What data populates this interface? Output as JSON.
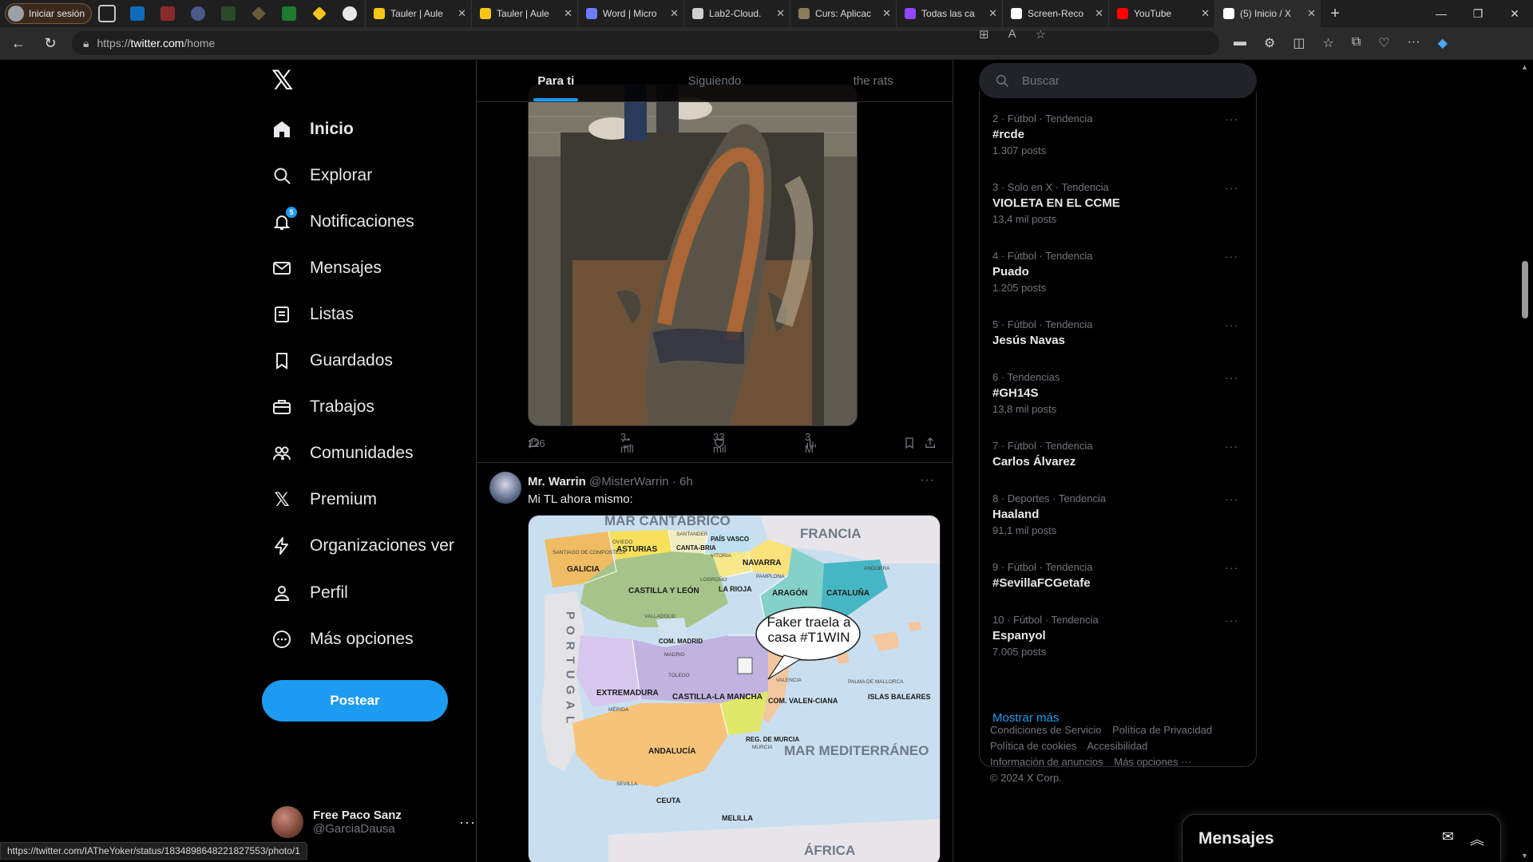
{
  "browser": {
    "profile_label": "Iniciar sesión",
    "tabs": [
      {
        "title": "Tauler | Aule",
        "color": "#f5c518"
      },
      {
        "title": "Tauler | Aule",
        "color": "#f5c518"
      },
      {
        "title": "Word | Micro",
        "color": "#6b7dff"
      },
      {
        "title": "Lab2-Cloud.",
        "color": "#cfcfcf"
      },
      {
        "title": "Curs: Aplicac",
        "color": "#8c7a5a"
      },
      {
        "title": "Todas las ca",
        "color": "#9146ff"
      },
      {
        "title": "Screen-Reco",
        "color": "#ffffff"
      },
      {
        "title": "YouTube",
        "color": "#ff0000"
      },
      {
        "title": "(5) Inicio / X",
        "color": "#ffffff"
      }
    ],
    "url_prefix": "https://",
    "url_host": "twitter.com",
    "url_path": "/home",
    "status_url": "https://twitter.com/IATheYoker/status/1834898648221827553/photo/1"
  },
  "nav": {
    "items": [
      {
        "label": "Inicio",
        "icon": "home-icon"
      },
      {
        "label": "Explorar",
        "icon": "search-icon"
      },
      {
        "label": "Notificaciones",
        "icon": "bell-icon",
        "badge": "5"
      },
      {
        "label": "Mensajes",
        "icon": "envelope-icon"
      },
      {
        "label": "Listas",
        "icon": "list-icon"
      },
      {
        "label": "Guardados",
        "icon": "bookmark-icon"
      },
      {
        "label": "Trabajos",
        "icon": "briefcase-icon"
      },
      {
        "label": "Comunidades",
        "icon": "people-icon"
      },
      {
        "label": "Premium",
        "icon": "x-logo-icon"
      },
      {
        "label": "Organizaciones ver",
        "icon": "lightning-icon"
      },
      {
        "label": "Perfil",
        "icon": "person-icon"
      },
      {
        "label": "Más opciones",
        "icon": "more-circle-icon"
      }
    ],
    "post_label": "Postear",
    "account": {
      "name": "Free Paco Sanz",
      "handle": "@GarciaDausa"
    }
  },
  "feed": {
    "tabs": [
      "Para ti",
      "Siguiendo",
      "the rats"
    ],
    "tweet1": {
      "replies": "226",
      "reposts": "3 mil",
      "likes": "33 mil",
      "views": "3 M"
    },
    "tweet2": {
      "name": "Mr. Warrin",
      "handle": "@MisterWarrin",
      "time": "6h",
      "text": "Mi TL ahora mismo:",
      "map": {
        "seas": [
          "MAR CANTÁBRICO",
          "MAR MEDITERRÁNEO"
        ],
        "countries": [
          "FRANCIA",
          "PORTUGAL",
          "ÁFRICA"
        ],
        "regions": [
          "GALICIA",
          "ASTURIAS",
          "CANTA-BRIA",
          "PAÍS VASCO",
          "NAVARRA",
          "LA RIOJA",
          "CASTILLA Y LEÓN",
          "ARAGÓN",
          "CATALUÑA",
          "COM. MADRID",
          "EXTREMADURA",
          "CASTILLA-LA MANCHA",
          "COM. VALEN-CIANA",
          "ISLAS BALEARES",
          "REG. DE MURCIA",
          "ANDALUCÍA",
          "CEUTA",
          "MELILLA"
        ],
        "cities": [
          "SANTIAGO DE COMPOSTELA",
          "OVIEDO",
          "SANTANDER",
          "VITORIA",
          "PAMPLONA",
          "LOGROÑO",
          "ANDORRA",
          "VALLADOLID",
          "MADRID",
          "TOLEDO",
          "MÉRIDA",
          "VALENCIA",
          "PALMA DE MALLORCA",
          "MURCIA",
          "SEVILLA"
        ],
        "bubble": "Faker traela a casa #T1WIN"
      }
    }
  },
  "sidebar": {
    "search_placeholder": "Buscar",
    "trends": [
      {
        "meta": "2 · Fútbol · Tendencia",
        "name": "#rcde",
        "count": "1.307 posts"
      },
      {
        "meta": "3 · Solo en X · Tendencia",
        "name": "VIOLETA EN EL CCME",
        "count": "13,4 mil posts"
      },
      {
        "meta": "4 · Fútbol · Tendencia",
        "name": "Puado",
        "count": "1.205 posts"
      },
      {
        "meta": "5 · Fútbol · Tendencia",
        "name": "Jesús Navas",
        "count": ""
      },
      {
        "meta": "6 · Tendencias",
        "name": "#GH14S",
        "count": "13,8 mil posts"
      },
      {
        "meta": "7 · Fútbol · Tendencia",
        "name": "Carlos Álvarez",
        "count": ""
      },
      {
        "meta": "8 · Deportes · Tendencia",
        "name": "Haaland",
        "count": "91,1 mil posts"
      },
      {
        "meta": "9 · Fútbol · Tendencia",
        "name": "#SevillaFCGetafe",
        "count": ""
      },
      {
        "meta": "10 · Fútbol · Tendencia",
        "name": "Espanyol",
        "count": "7.005 posts"
      }
    ],
    "show_more": "Mostrar más",
    "footer_links": [
      "Condiciones de Servicio",
      "Política de Privacidad",
      "Política de cookies",
      "Accesibilidad",
      "Información de anuncios",
      "Más opciones ···",
      "© 2024 X Corp."
    ]
  },
  "messages_drawer": {
    "title": "Mensajes"
  },
  "colors": {
    "accent": "#1d9bf0",
    "background": "#000000",
    "border": "#2f3336",
    "muted": "#71767b"
  }
}
